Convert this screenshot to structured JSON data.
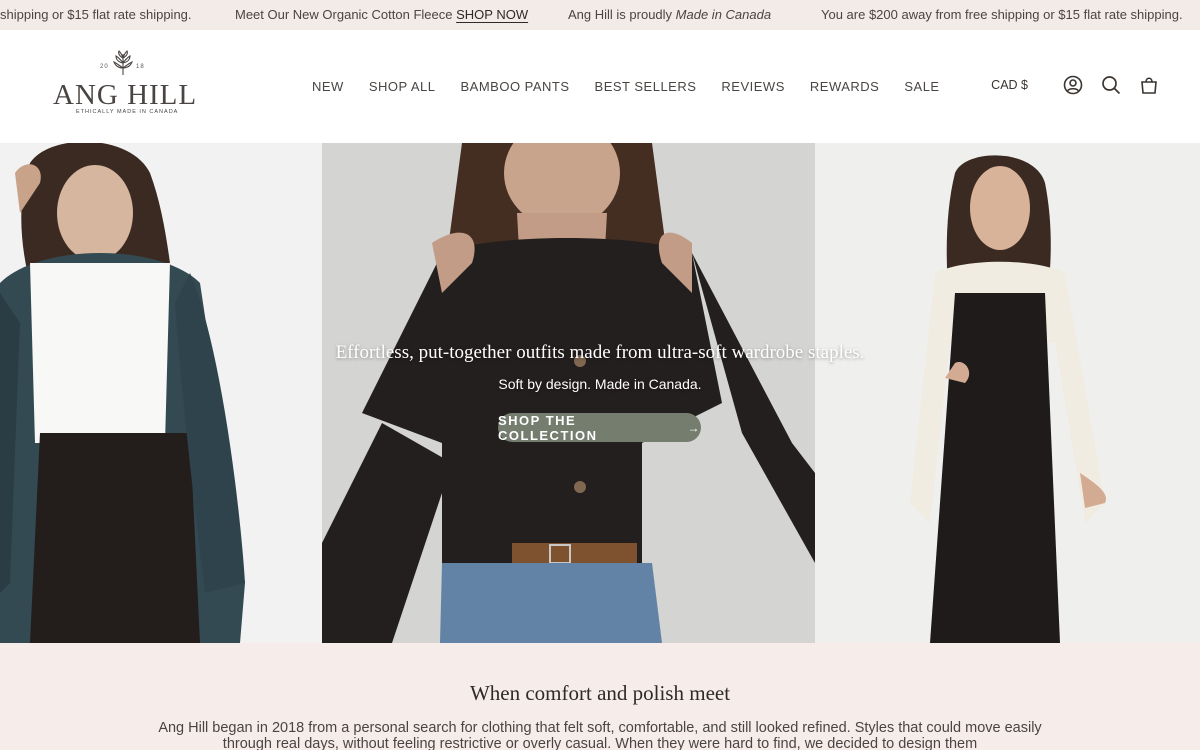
{
  "announcement": {
    "msg1": "shipping or $15 flat rate shipping.",
    "msg2_prefix": "Meet Our New Organic Cotton Fleece",
    "msg2_link": "SHOP NOW",
    "msg3_prefix": "Ang Hill is proudly",
    "msg3_em": "Made in Canada",
    "msg4": "You are $200 away from free shipping or $15 flat rate shipping."
  },
  "logo": {
    "year_left": "20",
    "year_right": "18",
    "wordmark": "ANG HILL",
    "tagline": "ETHICALLY MADE IN CANADA"
  },
  "nav": {
    "items": [
      "NEW",
      "SHOP ALL",
      "BAMBOO PANTS",
      "BEST SELLERS",
      "REVIEWS",
      "REWARDS",
      "SALE"
    ]
  },
  "header_tools": {
    "currency": "CAD $",
    "icons": [
      "account-icon",
      "search-icon",
      "cart-icon"
    ]
  },
  "hero": {
    "title": "Effortless, put-together outfits made from ultra-soft wardrobe staples.",
    "subtitle": "Soft by design. Made in Canada.",
    "button_label": "SHOP THE COLLECTION",
    "button_arrow": "→",
    "button_color": "#757d6f"
  },
  "story": {
    "heading": "When comfort and polish meet",
    "body": "Ang Hill began in 2018 from a personal search for clothing that felt soft, comfortable, and still looked refined. Styles that could move easily through real days, without feeling restrictive or overly casual. When they were hard to find, we decided to design them"
  },
  "colors": {
    "announcement_bg": "#f3ebe8",
    "story_bg": "#f6ece9",
    "text": "#4a4542"
  }
}
